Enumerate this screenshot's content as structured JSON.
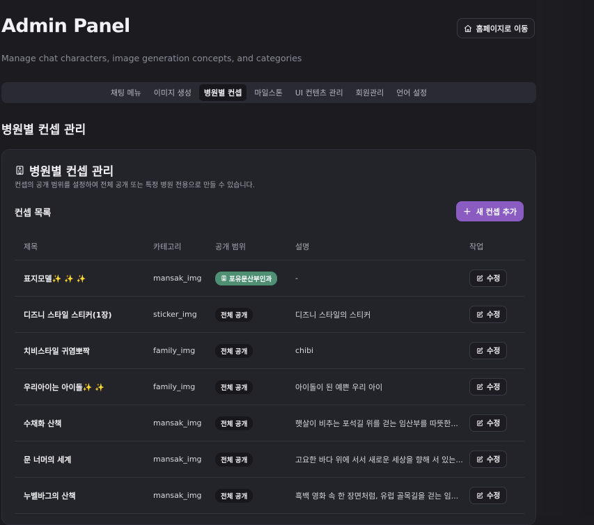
{
  "header": {
    "title": "Admin Panel",
    "subtitle": "Manage chat characters, image generation concepts, and categories",
    "home_button": "홈페이지로 이동"
  },
  "tabs": [
    {
      "label": "채팅 메뉴",
      "active": false
    },
    {
      "label": "이미지 생성",
      "active": false
    },
    {
      "label": "병원별 컨셉",
      "active": true
    },
    {
      "label": "마일스톤",
      "active": false
    },
    {
      "label": "UI 컨텐츠 관리",
      "active": false
    },
    {
      "label": "회원관리",
      "active": false
    },
    {
      "label": "언어 설정",
      "active": false
    }
  ],
  "section_heading": "병원별 컨셉 관리",
  "card": {
    "title": "병원별 컨셉 관리",
    "description": "컨셉의 공개 범위를 설정하여 전체 공개 또는 특정 병원 전용으로 만들 수 있습니다.",
    "list_title": "컨셉 목록",
    "add_button": "새 컨셉 추가"
  },
  "table": {
    "headers": [
      "제목",
      "카테고리",
      "공개 범위",
      "설명",
      "작업"
    ],
    "edit_label": "수정",
    "rows": [
      {
        "title": "표지모델✨ ✨ ✨",
        "category": "mansak_img",
        "visibility": "포유문산부인과",
        "visibility_type": "hospital",
        "description": "-"
      },
      {
        "title": "디즈니 스타일 스티커(1장)",
        "category": "sticker_img",
        "visibility": "전체 공개",
        "visibility_type": "public",
        "description": "디즈니 스타일의 스티커"
      },
      {
        "title": "치비스타일 귀염뽀짝",
        "category": "family_img",
        "visibility": "전체 공개",
        "visibility_type": "public",
        "description": "chibi"
      },
      {
        "title": "우리아이는 아이돌✨ ✨",
        "category": "family_img",
        "visibility": "전체 공개",
        "visibility_type": "public",
        "description": "아이돌이 된 예쁜 우리 아이"
      },
      {
        "title": "수채화 산책",
        "category": "mansak_img",
        "visibility": "전체 공개",
        "visibility_type": "public",
        "description": "햇살이 비추는 포석길 위를 걷는 임산부를 따뜻한..."
      },
      {
        "title": "문 너머의 세계",
        "category": "mansak_img",
        "visibility": "전체 공개",
        "visibility_type": "public",
        "description": "고요한 바다 위에 서서 새로운 세상을 향해 서 있는..."
      },
      {
        "title": "누벨바그의 산책",
        "category": "mansak_img",
        "visibility": "전체 공개",
        "visibility_type": "public",
        "description": "흑백 영화 속 한 장면처럼, 유럽 골목길을 걷는 임..."
      }
    ]
  },
  "colors": {
    "background": "#1b1b20",
    "card": "#23232a",
    "accent": "#8a5cc2",
    "hospital_badge": "#4f8f74"
  },
  "icons": {
    "home": "home-icon",
    "hospital": "hospital-icon",
    "add": "plus-icon",
    "edit": "edit-icon"
  }
}
